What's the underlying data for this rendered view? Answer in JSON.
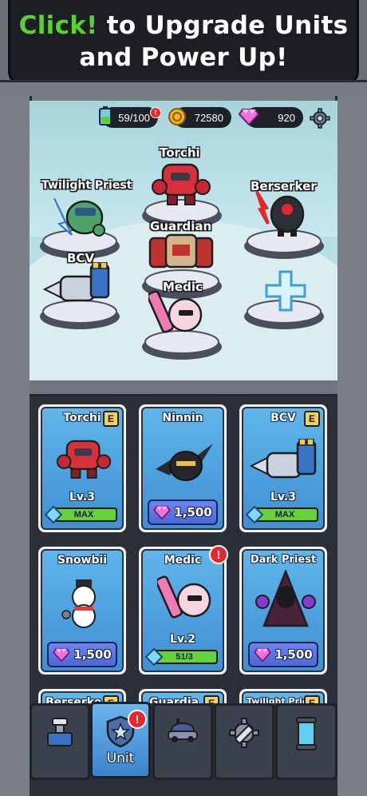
{
  "banner": {
    "line1_green": "Click!",
    "line1_rest": " to Upgrade Units",
    "line2": "and Power Up!"
  },
  "resources": {
    "energy": {
      "value": "59/100",
      "icon": "energy-battery-icon"
    },
    "gold": {
      "value": "72580",
      "icon": "gold-coin-icon"
    },
    "gems": {
      "value": "920",
      "icon": "gem-icon"
    },
    "settings_icon": "gear-icon"
  },
  "formation": {
    "units": [
      {
        "name": "Torchi"
      },
      {
        "name": "Twilight Priest"
      },
      {
        "name": "Berserker"
      },
      {
        "name": "Guardian"
      },
      {
        "name": "BCV"
      },
      {
        "name": "Medic"
      }
    ],
    "empty_slot_icon": "plus-icon"
  },
  "cards": [
    {
      "name": "Torchi",
      "badge": "E",
      "level": "Lv.3",
      "progress_text": "MAX",
      "progress": 1.0
    },
    {
      "name": "Ninnin",
      "price": "1,500"
    },
    {
      "name": "BCV",
      "badge": "E",
      "level": "Lv.3",
      "progress_text": "MAX",
      "progress": 1.0
    },
    {
      "name": "Snowbii",
      "price": "1,500"
    },
    {
      "name": "Medic",
      "alert": "!",
      "level": "Lv.2",
      "progress_text": "51/3",
      "progress": 1.0
    },
    {
      "name": "Dark Priest",
      "price": "1,500"
    },
    {
      "name": "Berserke",
      "badge": "E"
    },
    {
      "name": "Guardia",
      "badge": "E"
    },
    {
      "name": "Twilight Prie",
      "badge": "E"
    }
  ],
  "nav": {
    "tabs": [
      {
        "icon": "cannon-icon"
      },
      {
        "label": "Unit",
        "icon": "shield-icon",
        "alert": "!",
        "active": true
      },
      {
        "icon": "vehicle-icon"
      },
      {
        "icon": "gear-wrench-icon"
      },
      {
        "icon": "capsule-icon"
      }
    ]
  }
}
